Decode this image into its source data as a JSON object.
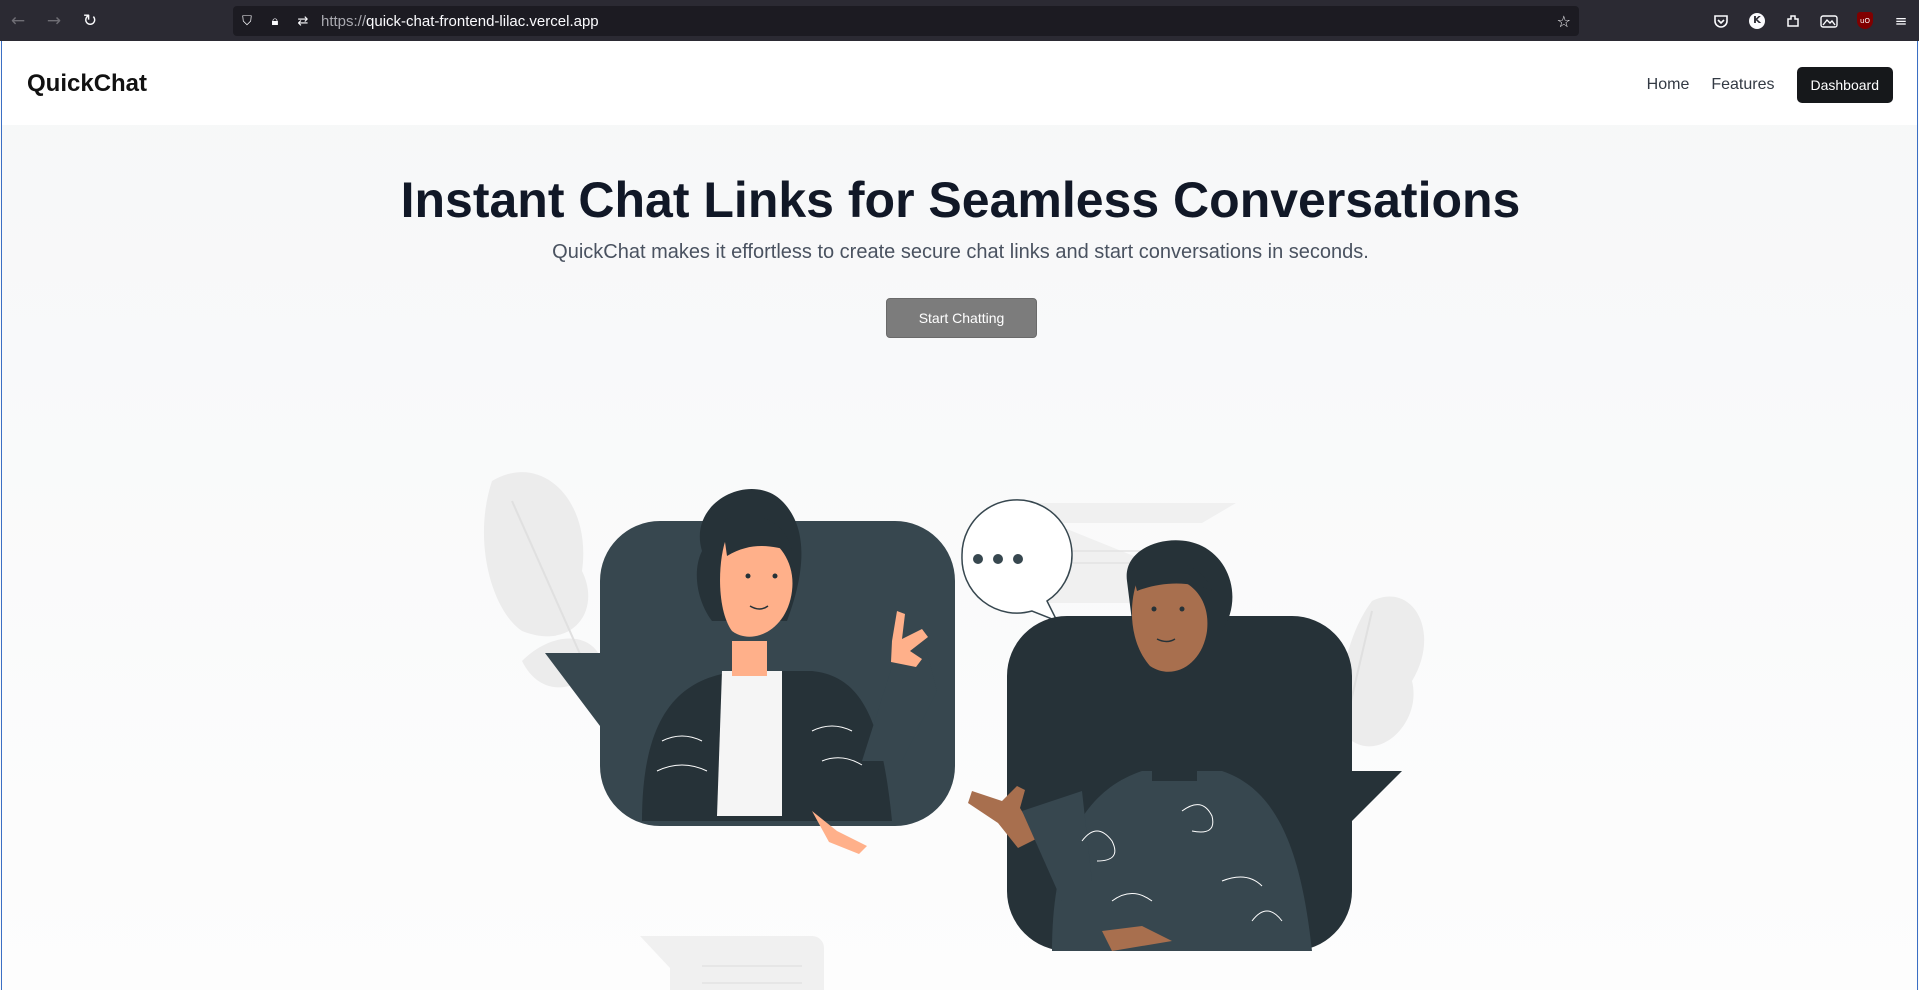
{
  "browser": {
    "url_protocol": "https://",
    "url_host": "quick-chat-frontend-lilac.vercel.app",
    "back_icon": "arrow-left-icon",
    "forward_icon": "arrow-right-icon",
    "reload_icon": "reload-icon",
    "account_initial": "K",
    "ublock_label": "uO"
  },
  "header": {
    "brand": "QuickChat",
    "nav": [
      {
        "label": "Home"
      },
      {
        "label": "Features"
      }
    ],
    "dashboard_label": "Dashboard"
  },
  "hero": {
    "title": "Instant Chat Links for Seamless Conversations",
    "subtitle": "QuickChat makes it effortless to create secure chat links and start conversations in seconds.",
    "cta_label": "Start Chatting"
  },
  "colors": {
    "dark_card": "#37474f",
    "darker_card": "#263238",
    "skin_light": "#ffb08a",
    "skin_dark": "#a86f4e"
  }
}
